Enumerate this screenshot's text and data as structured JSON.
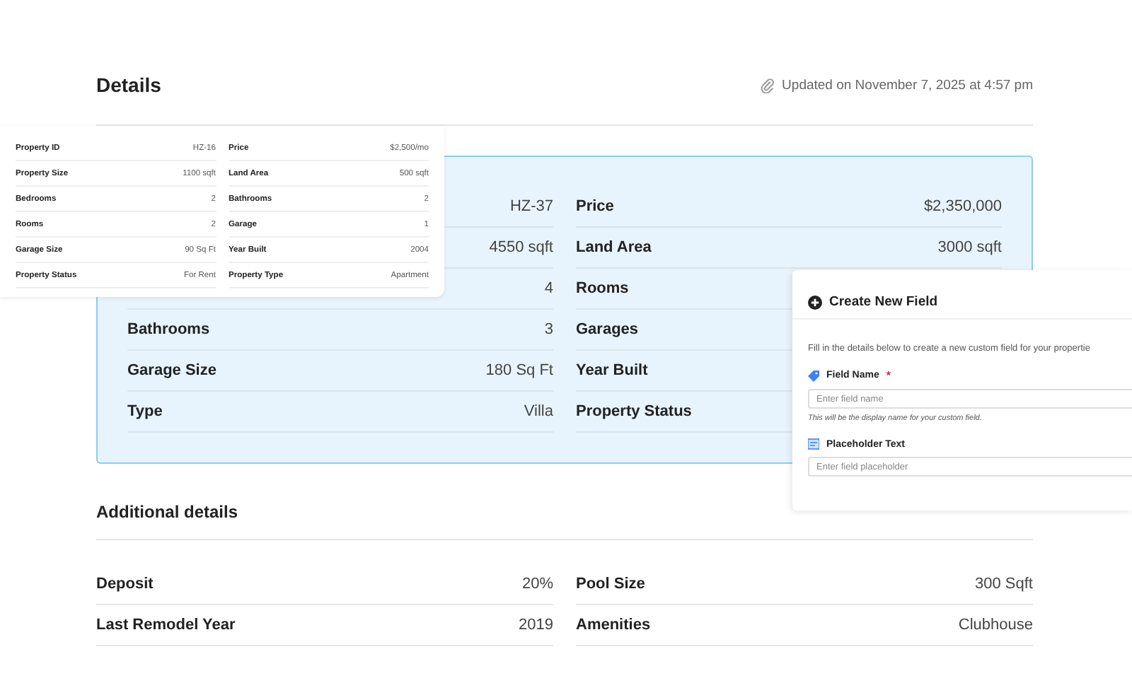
{
  "details": {
    "title": "Details",
    "updated": "Updated on November 7, 2025 at 4:57 pm",
    "card": {
      "highlighted": true,
      "left": [
        {
          "value": "HZ-37"
        },
        {
          "value": "4550 sqft"
        },
        {
          "value": "4"
        },
        {
          "label": "Bathrooms",
          "value": "3"
        },
        {
          "label": "Garage Size",
          "value": "180 Sq Ft"
        },
        {
          "label": "Type",
          "value": "Villa"
        }
      ],
      "right": [
        {
          "label": "Price",
          "value": "$2,350,000"
        },
        {
          "label": "Land Area",
          "value": "3000 sqft"
        },
        {
          "label": "Rooms"
        },
        {
          "label": "Garages"
        },
        {
          "label": "Year Built"
        },
        {
          "label": "Property Status"
        }
      ]
    }
  },
  "additional": {
    "title": "Additional details",
    "left": [
      {
        "label": "Deposit",
        "value": "20%"
      },
      {
        "label": "Last Remodel Year",
        "value": "2019"
      }
    ],
    "right": [
      {
        "label": "Pool Size",
        "value": "300 Sqft"
      },
      {
        "label": "Amenities",
        "value": "Clubhouse"
      }
    ]
  },
  "preview": {
    "left": [
      {
        "label": "Property ID",
        "value": "HZ-16"
      },
      {
        "label": "Property Size",
        "value": "1100 sqft"
      },
      {
        "label": "Bedrooms",
        "value": "2"
      },
      {
        "label": "Rooms",
        "value": "2"
      },
      {
        "label": "Garage Size",
        "value": "90 Sq Ft"
      },
      {
        "label": "Property Status",
        "value": "For Rent"
      }
    ],
    "right": [
      {
        "label": "Price",
        "value": "$2,500/mo"
      },
      {
        "label": "Land Area",
        "value": "500 sqft"
      },
      {
        "label": "Bathrooms",
        "value": "2"
      },
      {
        "label": "Garage",
        "value": "1"
      },
      {
        "label": "Year Built",
        "value": "2004"
      },
      {
        "label": "Property Type",
        "value": "Apartment"
      }
    ]
  },
  "create_field": {
    "title": "Create New Field",
    "required_mark": "*",
    "description": "Fill in the details below to create a new custom field for your propertie",
    "fields": [
      {
        "label": "Field Name",
        "required": true,
        "placeholder": "Enter field name",
        "hint": "This will be the display name for your custom field.",
        "kind": "tag"
      },
      {
        "label": "Placeholder Text",
        "required": false,
        "placeholder": "Enter field placeholder",
        "kind": "text"
      }
    ]
  }
}
